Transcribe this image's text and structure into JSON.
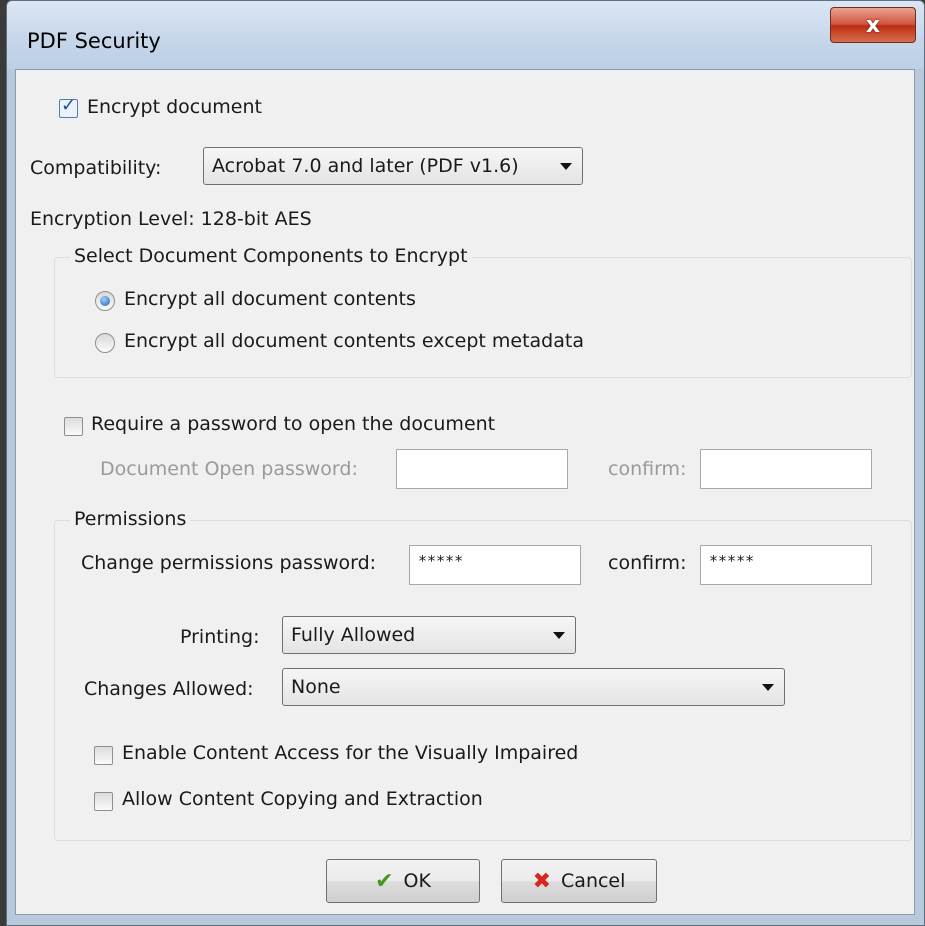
{
  "window": {
    "title": "PDF Security",
    "close_label": "x"
  },
  "encrypt": {
    "label": "Encrypt document",
    "checked": true
  },
  "compatibility": {
    "label": "Compatibility:",
    "value": "Acrobat 7.0 and later (PDF v1.6)"
  },
  "encryption_level": {
    "text": "Encryption Level: 128-bit AES"
  },
  "components": {
    "legend": "Select Document Components to Encrypt",
    "options": [
      {
        "label": "Encrypt all document contents",
        "selected": true
      },
      {
        "label": "Encrypt all document contents except metadata",
        "selected": false
      }
    ]
  },
  "open_password": {
    "require_label": "Require a password to open the document",
    "checked": false,
    "field_label": "Document Open password:",
    "value": "",
    "confirm_label": "confirm:",
    "confirm_value": ""
  },
  "permissions": {
    "legend": "Permissions",
    "change_label": "Change permissions password:",
    "change_value": "*****",
    "confirm_label": "confirm:",
    "confirm_value": "*****",
    "printing_label": "Printing:",
    "printing_value": "Fully Allowed",
    "changes_label": "Changes Allowed:",
    "changes_value": "None",
    "checkboxes": [
      {
        "label": "Enable Content Access for the Visually Impaired",
        "checked": false
      },
      {
        "label": "Allow Content Copying and Extraction",
        "checked": false
      }
    ]
  },
  "buttons": {
    "ok": "OK",
    "cancel": "Cancel"
  },
  "icons": {
    "ok": "checkmark-icon",
    "cancel": "x-icon"
  },
  "colors": {
    "titlebar": "#c7d7ea",
    "close_button": "#c8432a",
    "ok_icon": "#3f9a1f",
    "cancel_icon": "#d8261b",
    "radio_selected": "#1a5fb4"
  }
}
